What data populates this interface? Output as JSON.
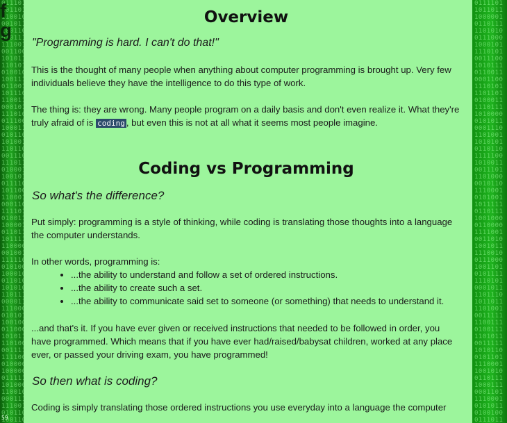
{
  "article": {
    "heading_overview": "Overview",
    "quote": "\"Programming is hard. I can't do that!\"",
    "para1": "This is the thought of many people when anything about computer programming is brought up. Very few individuals believe they have the intelligence to do this type of work.",
    "para2_before": "The thing is: they are wrong. Many people program on a daily basis and don't even realize it. What they're truly afraid of is ",
    "para2_code": "coding",
    "para2_after": ", but even this is not at all what it seems most people imagine.",
    "heading_coding_vs": "Coding vs Programming",
    "subhead_difference": "So what's the difference?",
    "para3": "Put simply: programming is a style of thinking, while coding is translating those thoughts into a language the computer understands.",
    "para4_intro": "In other words, programming is:",
    "list_items": [
      "...the ability to understand and follow a set of ordered instructions.",
      "...the ability to create such a set.",
      "...the ability to communicate said set to someone (or something) that needs to understand it."
    ],
    "para5": "...and that's it. If you have ever given or received instructions that needed to be followed in order, you have programmed. Which means that if you have ever had/raised/babysat children, worked at any place ever, or passed your driving exam, you have programmed!",
    "subhead_coding": "So then what is coding?",
    "para6": "Coding is simply translating those ordered instructions you use everyday into a language the computer"
  },
  "sidebar_left": {
    "edge_letters": [
      "f",
      "g"
    ],
    "page_number": "59"
  },
  "background": {
    "left_binary": "011101\n101101\n110010\n001011\n100110\n010111\n111001\n001100\n101011\n110101\n010010\n100111\n011001\n101110\n110011\n000101\n111010\n011100\n100011\n010110\n101001\n110110\n001110\n111011\n010001\n100101\n011110\n101100\n110001\n000110\n111101\n010011\n100001\n011011\n101111\n110000\n001001\n111110\n010100\n100010\n011010\n101010\n110111\n000011\n111000\n010101\n100100\n011000\n101011\n110100\n001111\n111100\n010000\n100000\n011111\n101000\n110010\n000111\n111001\n010110\n100110\n011101",
    "right_binary": "0111101\n1011011\n1000001\n0110111\n1101010\n0111000\n1000101\n1110101\n0011100\n1010111\n0110011\n0001100\n1110101\n1101101\n0100011\n1110111\n1010000\n0101011\n0001110\n1101001\n1010101\n0110110\n1111100\n1010011\n0011101\n1101000\n0010110\n1110001\n0101001\n1011111\n0110111\n1001000\n0110000\n1111001\n0011010\n1001011\n1110010\n0111000\n1001101\n0101111\n1110101\n0001011\n1101110\n1011011\n1101001\n0011111\n1100111\n0100111\n1101011\n0011111\n1010110\n0101101\n1110001\n1001010\n0110111\n1000111\n0001101\n1110001\n0101011\n0100100\n0111011",
    "main_background_color": "#9cf59c",
    "strip_color": "#1fa31f"
  }
}
